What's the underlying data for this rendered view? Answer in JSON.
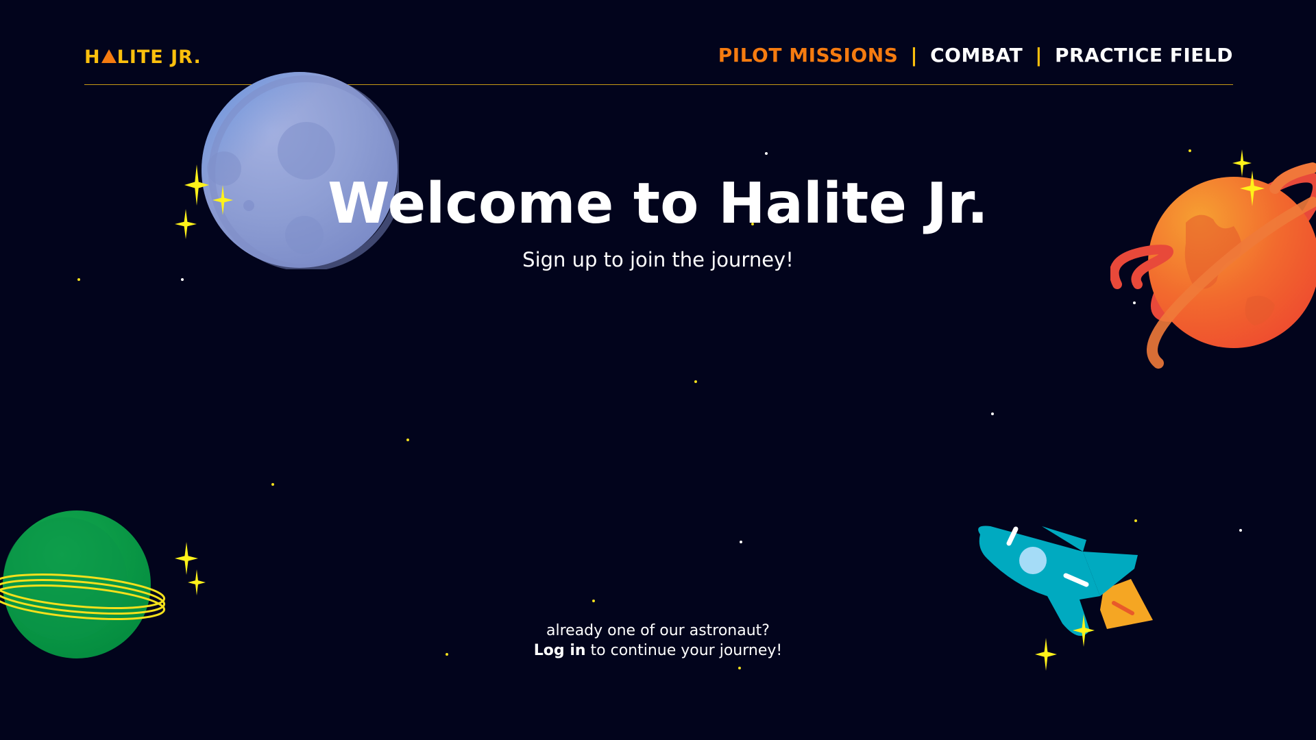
{
  "header": {
    "logo": {
      "prefix": "H",
      "suffix": "LITE JR."
    },
    "nav": [
      {
        "label": "PILOT MISSIONS",
        "active": true
      },
      {
        "label": "COMBAT",
        "active": false
      },
      {
        "label": "PRACTICE FIELD",
        "active": false
      }
    ],
    "separator": "|"
  },
  "hero": {
    "title": "Welcome to Halite Jr.",
    "subtitle": "Sign up to join the journey!"
  },
  "footer": {
    "question": "already one of our astronaut?",
    "login_label": "Log in",
    "login_suffix": " to continue your journey!"
  },
  "colors": {
    "background": "#02041c",
    "accent_yellow": "#fcc00d",
    "accent_orange": "#f57b10",
    "text": "#ffffff"
  },
  "icons": [
    "moon-planet",
    "ringed-orange-planet",
    "ringed-green-planet",
    "rocket-ship",
    "sparkle-star"
  ]
}
